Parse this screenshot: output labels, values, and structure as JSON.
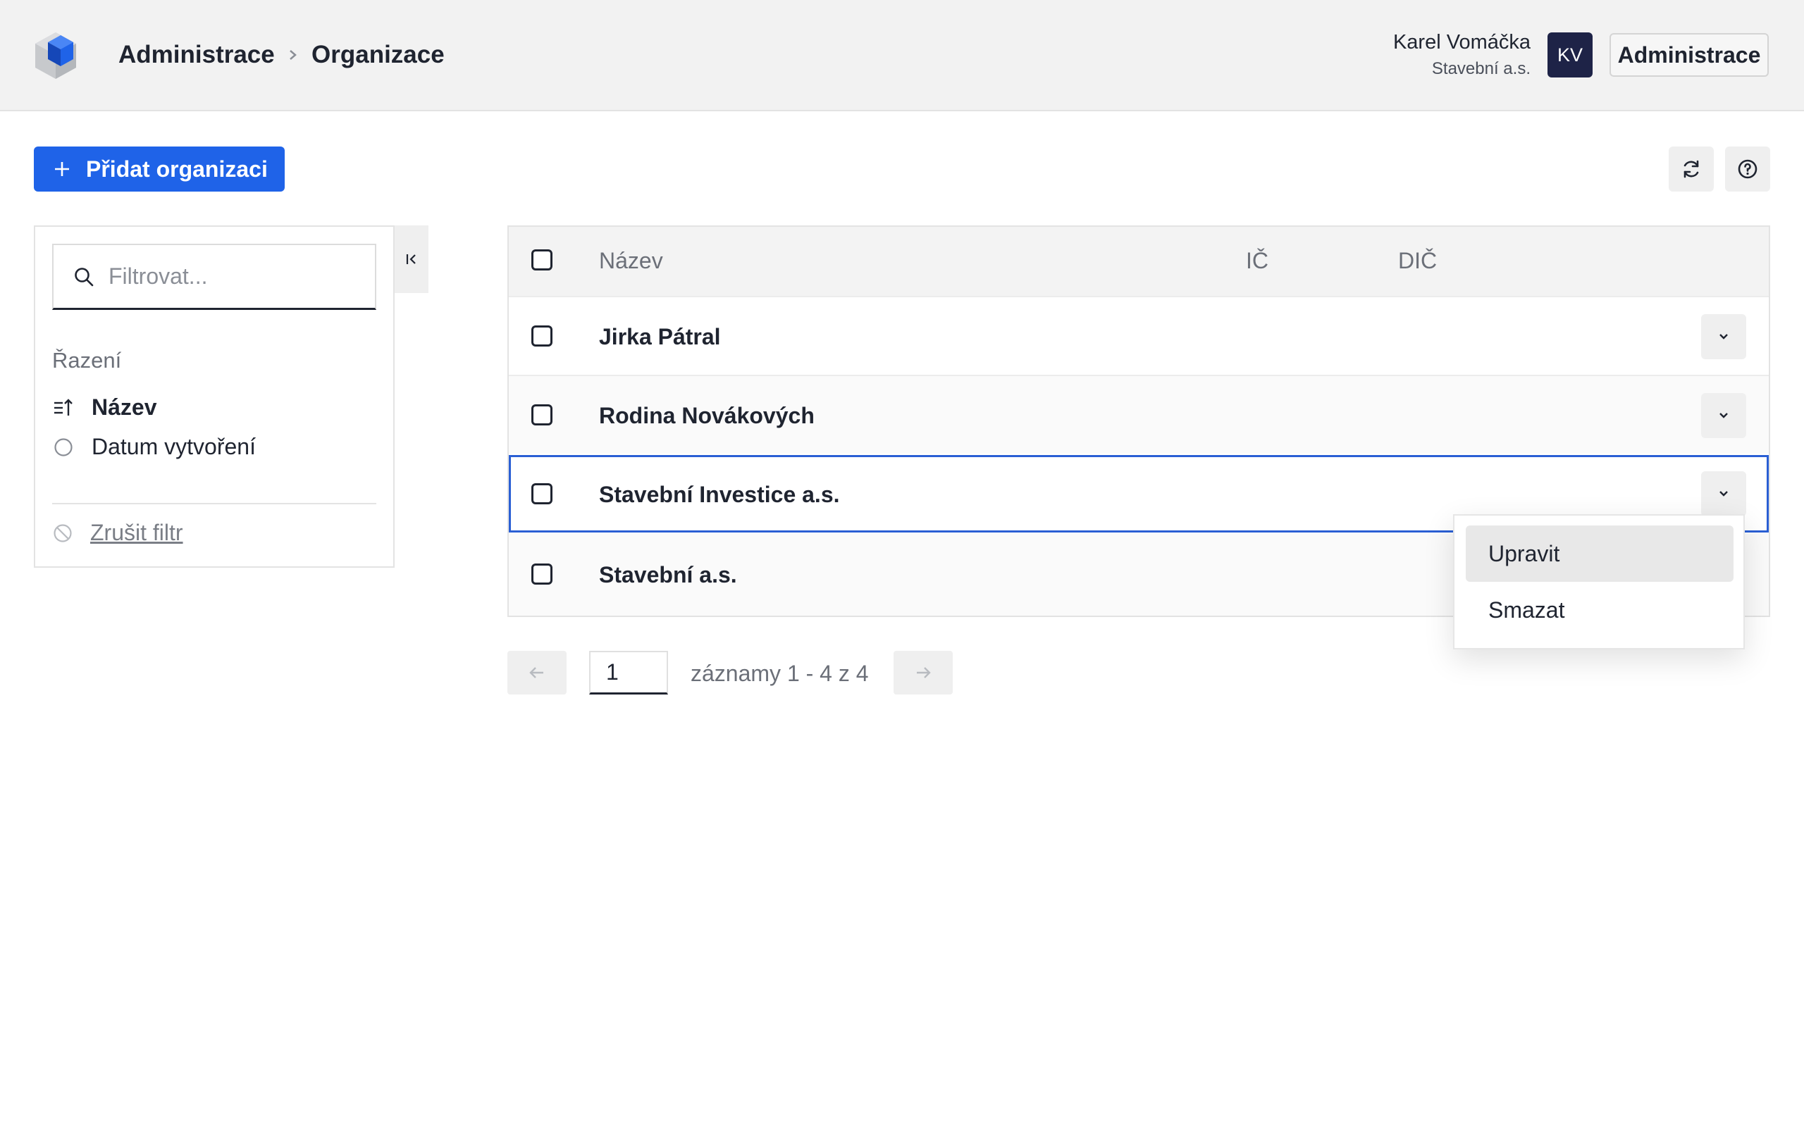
{
  "header": {
    "breadcrumb": [
      "Administrace",
      "Organizace"
    ],
    "user_name": "Karel Vomáčka",
    "user_org": "Stavební a.s.",
    "avatar_initials": "KV",
    "admin_button": "Administrace"
  },
  "toolbar": {
    "add_label": "Přidat organizaci",
    "icons": [
      "refresh-icon",
      "help-icon"
    ]
  },
  "sidebar": {
    "search_placeholder": "Filtrovat...",
    "sort_title": "Řazení",
    "sort_options": [
      {
        "label": "Název",
        "active": true
      },
      {
        "label": "Datum vytvoření",
        "active": false
      }
    ],
    "clear_filter": "Zrušit filtr"
  },
  "table": {
    "columns": [
      "Název",
      "IČ",
      "DIČ"
    ],
    "rows": [
      {
        "name": "Jirka Pátral",
        "ic": "",
        "dic": ""
      },
      {
        "name": "Rodina Novákových",
        "ic": "",
        "dic": ""
      },
      {
        "name": "Stavební Investice a.s.",
        "ic": "",
        "dic": "",
        "selected": true
      },
      {
        "name": "Stavební a.s.",
        "ic": "",
        "dic": ""
      }
    ]
  },
  "row_menu": {
    "items": [
      "Upravit",
      "Smazat"
    ]
  },
  "pagination": {
    "page": "1",
    "info": "záznamy 1 - 4 z 4"
  },
  "colors": {
    "primary": "#1f63e8",
    "avatar_bg": "#1e2347",
    "selected_border": "#2a5fd4"
  }
}
